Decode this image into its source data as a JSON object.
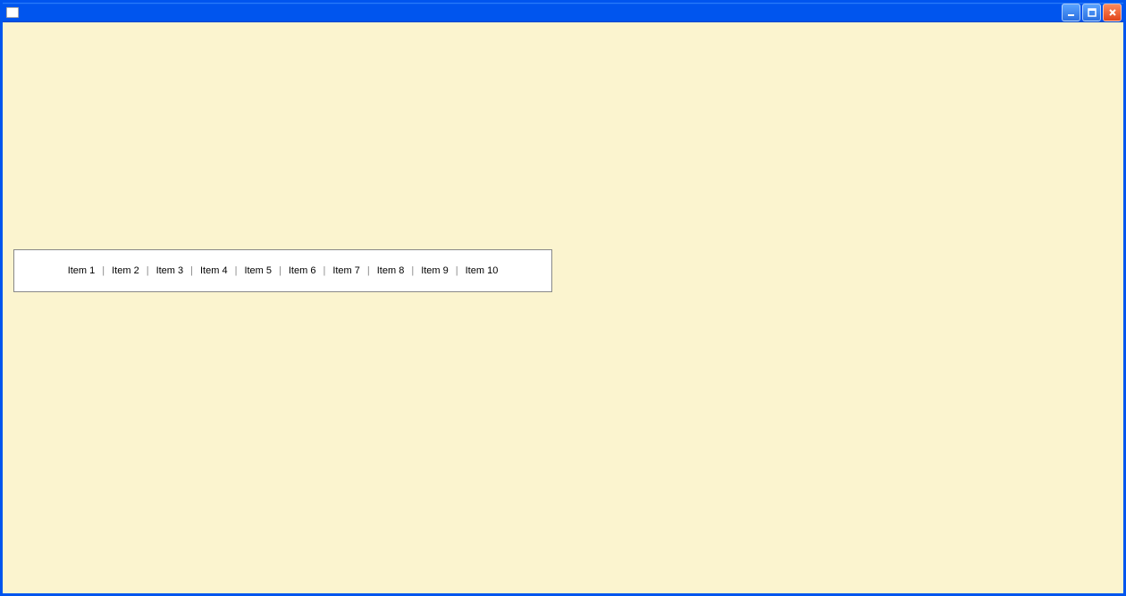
{
  "window": {
    "title": ""
  },
  "toolbar": {
    "items": [
      "Item 1",
      "Item 2",
      "Item 3",
      "Item 4",
      "Item 5",
      "Item 6",
      "Item 7",
      "Item 8",
      "Item 9",
      "Item 10"
    ],
    "separator": "|"
  }
}
